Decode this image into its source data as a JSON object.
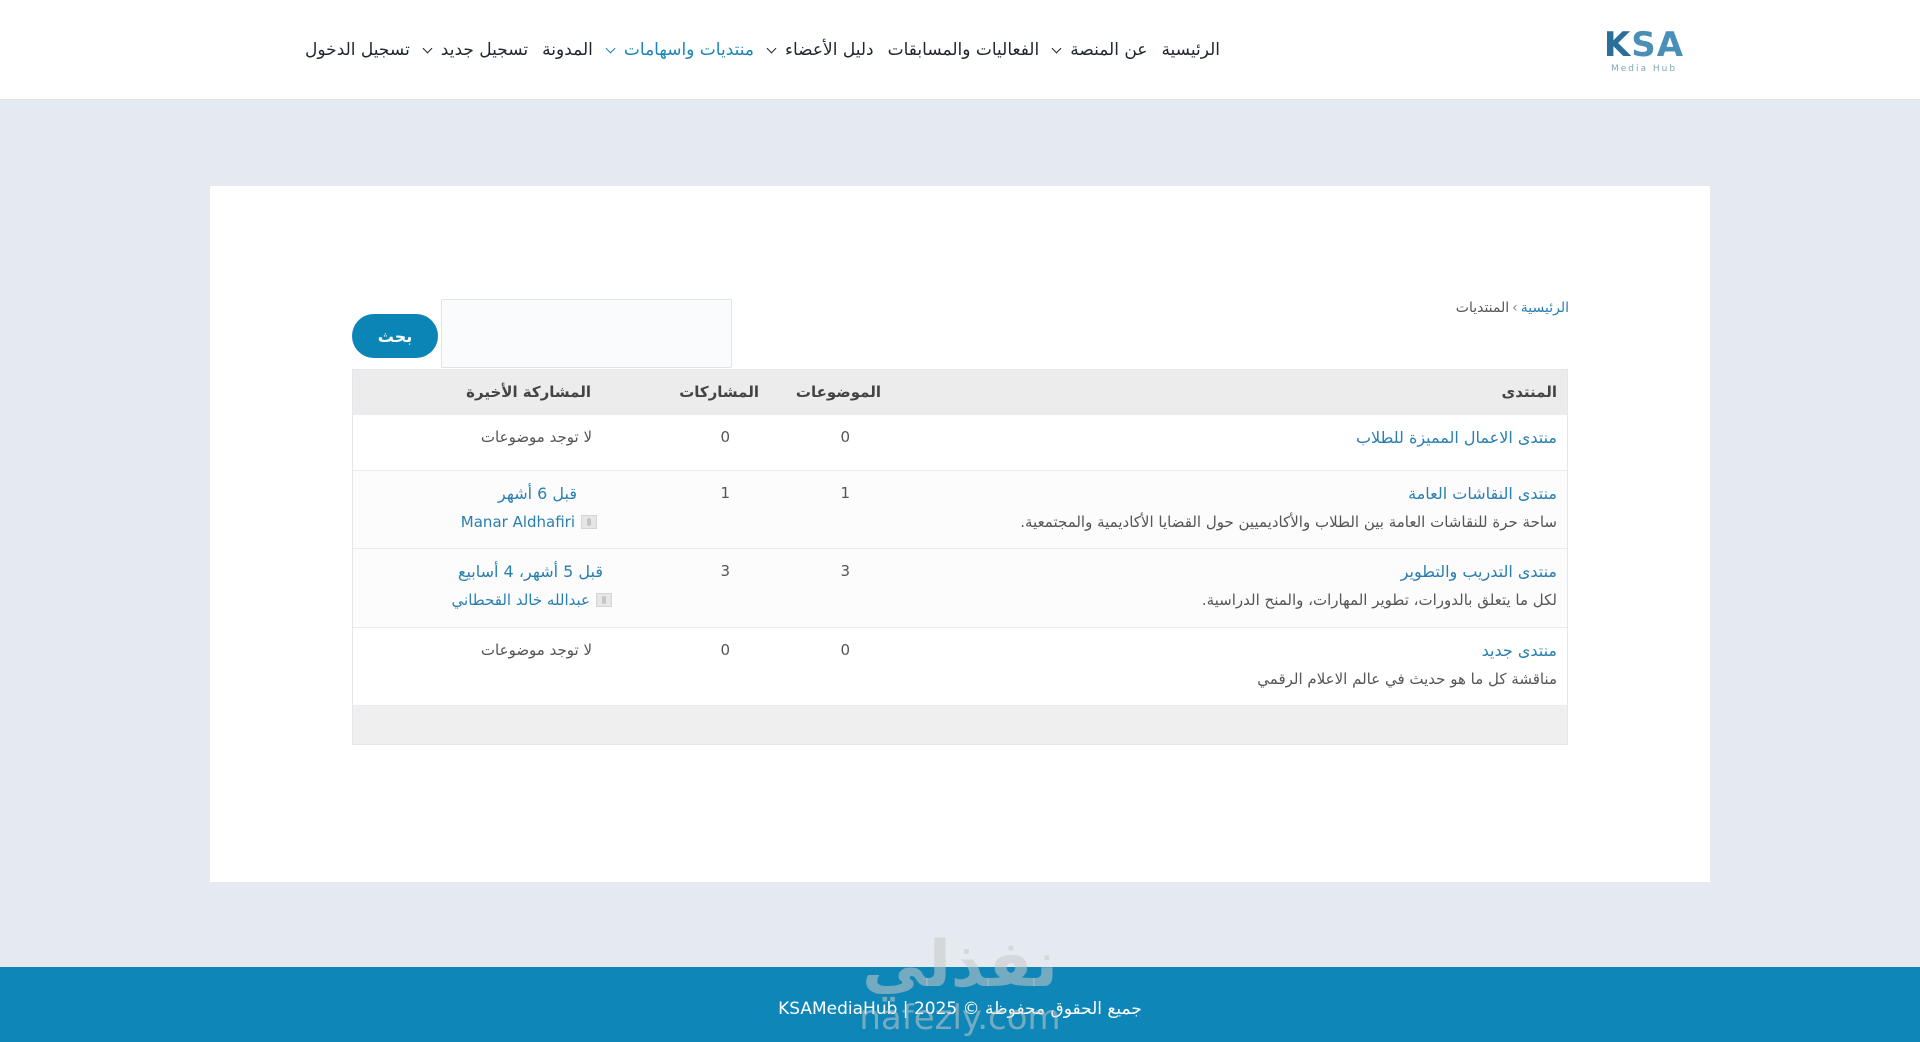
{
  "header": {
    "logo": {
      "mark_k": "K",
      "mark_rest": "SA",
      "subtitle": "Media Hub"
    },
    "nav": [
      {
        "label": "الرئيسية",
        "dropdown": false,
        "active": false
      },
      {
        "label": "عن المنصة",
        "dropdown": true,
        "active": false
      },
      {
        "label": "الفعاليات والمسابقات",
        "dropdown": false,
        "active": false
      },
      {
        "label": "دليل الأعضاء",
        "dropdown": true,
        "active": false
      },
      {
        "label": "منتديات واسهامات",
        "dropdown": true,
        "active": true
      },
      {
        "label": "المدونة",
        "dropdown": false,
        "active": false
      },
      {
        "label": "تسجيل جديد",
        "dropdown": true,
        "active": false
      },
      {
        "label": "تسجيل الدخول",
        "dropdown": false,
        "active": false
      }
    ]
  },
  "breadcrumb": {
    "home": "الرئيسية",
    "separator": "›",
    "current": "المنتديات"
  },
  "search": {
    "value": "",
    "button_label": "بحث"
  },
  "table": {
    "headers": {
      "forum": "المنتدى",
      "topics": "الموضوعات",
      "posts": "المشاركات",
      "last": "المشاركة الأخيرة"
    },
    "rows": [
      {
        "title": "منتدى الاعمال المميزة للطلاب",
        "description": "",
        "topics": "0",
        "posts": "0",
        "last_text": "لا توجد موضوعات"
      },
      {
        "title": "منتدى النقاشات العامة",
        "description": "ساحة حرة للنقاشات العامة بين الطلاب والأكاديميين حول القضايا الأكاديمية والمجتمعية.",
        "topics": "1",
        "posts": "1",
        "last_time": "قبل 6 أشهر",
        "last_user": "Manar Aldhafiri"
      },
      {
        "title": "منتدى التدريب والتطوير",
        "description": "لكل ما يتعلق بالدورات، تطوير المهارات، والمنح الدراسية.",
        "topics": "3",
        "posts": "3",
        "last_time": "قبل 5 أشهر، 4 أسابيع",
        "last_user": "عبدالله خالد القحطاني"
      },
      {
        "title": "منتدى جديد",
        "description": "مناقشة كل ما هو حديث في عالم الاعلام الرقمي",
        "topics": "0",
        "posts": "0",
        "last_text": "لا توجد موضوعات"
      }
    ]
  },
  "footer": {
    "text": "جميع الحقوق محفوظة © 2025 | KSAMediaHub"
  },
  "watermark": {
    "arabic": "نفذلي",
    "latin": "nafezly.com"
  },
  "colors": {
    "accent": "#0b84b6",
    "link": "#2a7fb0",
    "background": "#e4eaef",
    "footer": "#0e87b8"
  }
}
